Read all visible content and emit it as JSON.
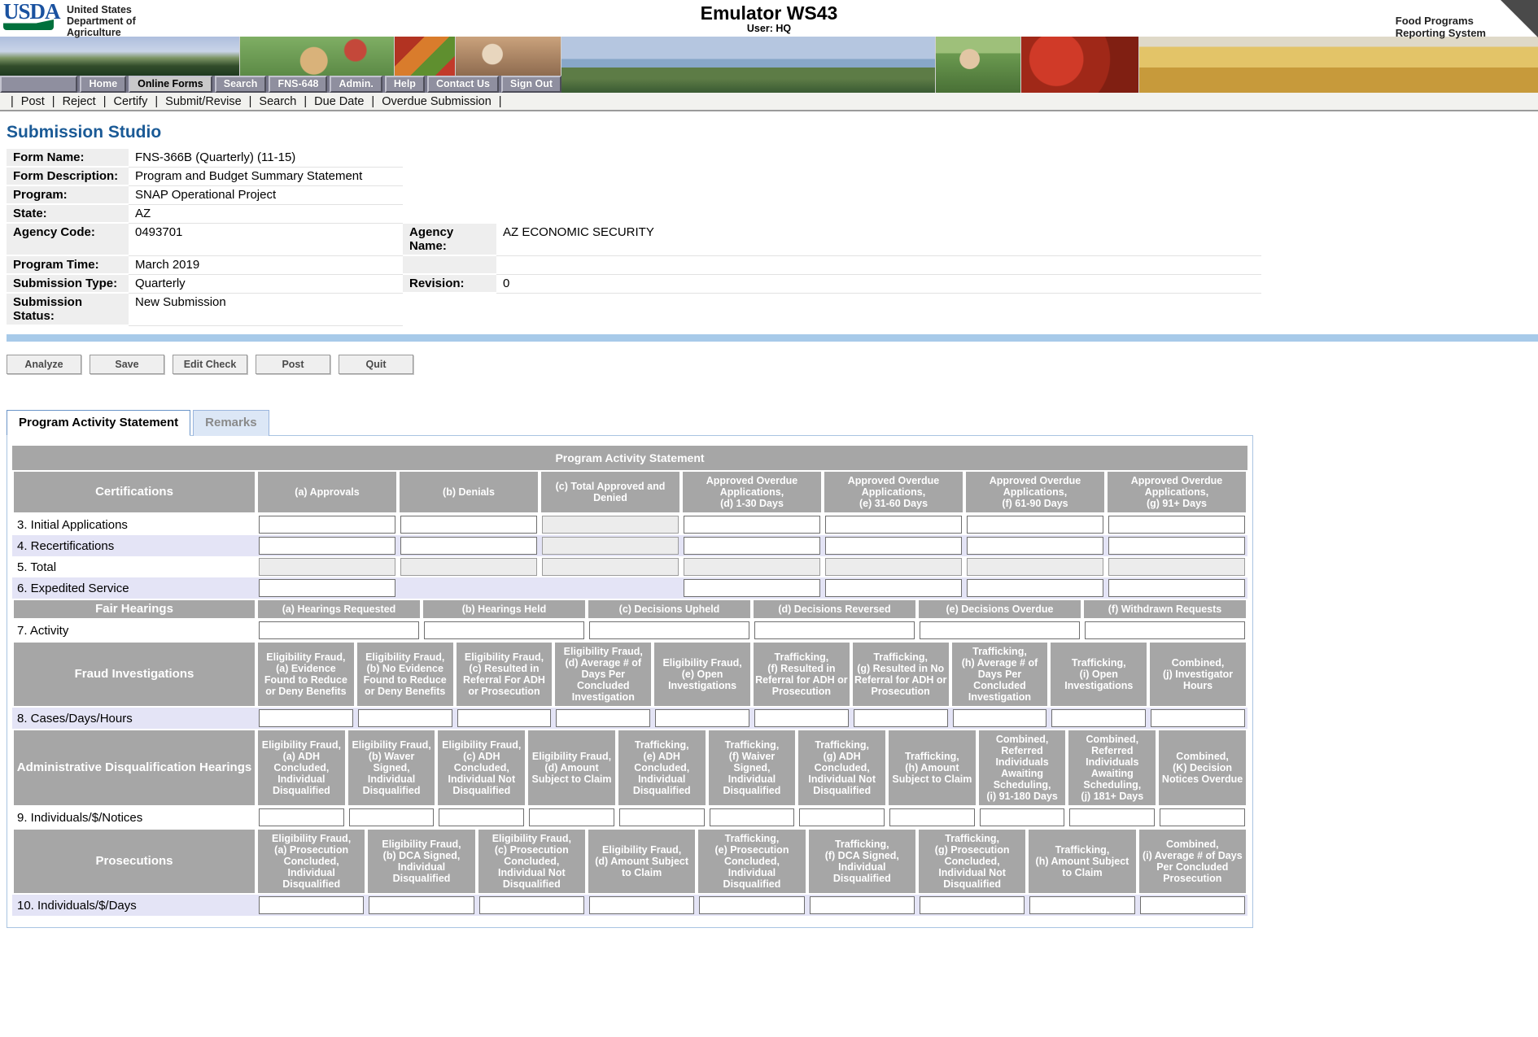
{
  "header": {
    "logo": "USDA",
    "agency_lines": [
      "United States",
      "Department of",
      "Agriculture"
    ],
    "title": "Emulator WS43",
    "user_label": "User: HQ",
    "system_lines": [
      "Food Programs",
      "Reporting System"
    ]
  },
  "nav": {
    "items": [
      {
        "label": "Home",
        "active": false
      },
      {
        "label": "Online Forms",
        "active": true
      },
      {
        "label": "Search",
        "active": false
      },
      {
        "label": "FNS-648",
        "active": false
      },
      {
        "label": "Admin.",
        "active": false
      },
      {
        "label": "Help",
        "active": false
      },
      {
        "label": "Contact Us",
        "active": false
      },
      {
        "label": "Sign Out",
        "active": false
      }
    ]
  },
  "subnav": {
    "items": [
      "Post",
      "Reject",
      "Certify",
      "Submit/Revise",
      "Search",
      "Due Date",
      "Overdue Submission"
    ]
  },
  "page_title": "Submission Studio",
  "metadata": {
    "rows": [
      {
        "label": "Form Name:",
        "value": "FNS-366B (Quarterly) (11-15)",
        "label2": null,
        "value2": null
      },
      {
        "label": "Form Description:",
        "value": "Program and Budget Summary Statement",
        "label2": null,
        "value2": null
      },
      {
        "label": "Program:",
        "value": "SNAP Operational Project",
        "label2": null,
        "value2": null
      },
      {
        "label": "State:",
        "value": "AZ",
        "label2": null,
        "value2": null
      },
      {
        "label": "Agency Code:",
        "value": "0493701",
        "label2": "Agency Name:",
        "value2": "AZ ECONOMIC SECURITY"
      },
      {
        "label": "Program Time:",
        "value": "March 2019",
        "label2": "",
        "value2": ""
      },
      {
        "label": "Submission Type:",
        "value": "Quarterly",
        "label2": "Revision:",
        "value2": "0"
      },
      {
        "label": "Submission Status:",
        "value": "New Submission",
        "label2": null,
        "value2": null
      }
    ]
  },
  "toolbar": {
    "buttons": [
      "Analyze",
      "Save",
      "Edit Check",
      "Post",
      "Quit"
    ]
  },
  "tabs": [
    {
      "label": "Program Activity Statement",
      "active": true
    },
    {
      "label": "Remarks",
      "active": false
    }
  ],
  "table": {
    "title": "Program Activity Statement",
    "sections": [
      {
        "name": "Certifications",
        "columns": [
          "(a) Approvals",
          "(b) Denials",
          "(c) Total Approved and Denied",
          "Approved Overdue Applications,\n(d) 1-30 Days",
          "Approved Overdue Applications,\n(e) 31-60 Days",
          "Approved Overdue Applications,\n(f) 61-90 Days",
          "Approved Overdue Applications,\n(g) 91+ Days"
        ],
        "rows": [
          {
            "label": "3. Initial Applications",
            "shade": false,
            "cells": [
              "input",
              "input",
              "disabled",
              "input",
              "input",
              "input",
              "input"
            ]
          },
          {
            "label": "4. Recertifications",
            "shade": true,
            "cells": [
              "input",
              "input",
              "disabled",
              "input",
              "input",
              "input",
              "input"
            ]
          },
          {
            "label": "5. Total",
            "shade": false,
            "cells": [
              "disabled",
              "disabled",
              "disabled",
              "disabled",
              "disabled",
              "disabled",
              "disabled"
            ]
          },
          {
            "label": "6. Expedited Service",
            "shade": true,
            "cells": [
              "input",
              "empty",
              "empty",
              "input",
              "input",
              "input",
              "input"
            ]
          }
        ]
      },
      {
        "name": "Fair Hearings",
        "columns": [
          "(a) Hearings Requested",
          "(b) Hearings Held",
          "(c) Decisions Upheld",
          "(d) Decisions Reversed",
          "(e) Decisions Overdue",
          "(f) Withdrawn Requests"
        ],
        "rows": [
          {
            "label": "7. Activity",
            "shade": false,
            "cells": [
              "input",
              "input",
              "input",
              "input",
              "input",
              "input"
            ]
          }
        ]
      },
      {
        "name": "Fraud Investigations",
        "columns": [
          "Eligibility Fraud,\n(a) Evidence Found to Reduce or Deny Benefits",
          "Eligibility Fraud,\n(b) No Evidence Found to Reduce or Deny Benefits",
          "Eligibility Fraud,\n(c) Resulted in Referral For ADH or Prosecution",
          "Eligibility Fraud,\n(d) Average # of Days Per Concluded Investigation",
          "Eligibility Fraud,\n(e) Open Investigations",
          "Trafficking,\n(f) Resulted in Referral for ADH or Prosecution",
          "Trafficking,\n(g) Resulted in No Referral for ADH or Prosecution",
          "Trafficking,\n(h) Average # of Days Per Concluded Investigation",
          "Trafficking,\n(i) Open Investigations",
          "Combined,\n(j) Investigator Hours"
        ],
        "rows": [
          {
            "label": "8. Cases/Days/Hours",
            "shade": true,
            "cells": [
              "input",
              "input",
              "input",
              "input",
              "input",
              "input",
              "input",
              "input",
              "input",
              "input"
            ]
          }
        ]
      },
      {
        "name": "Administrative Disqualification Hearings",
        "columns": [
          "Eligibility Fraud,\n(a) ADH Concluded,\nIndividual Disqualified",
          "Eligibility Fraud,\n(b) Waver Signed,\nIndividual Disqualified",
          "Eligibility Fraud,\n(c) ADH Concluded,\nIndividual Not Disqualified",
          "Eligibility Fraud,\n(d) Amount Subject to Claim",
          "Trafficking,\n(e) ADH Concluded,\nIndividual Disqualified",
          "Trafficking,\n(f) Waiver Signed,\nIndividual Disqualified",
          "Trafficking,\n(g) ADH Concluded,\nIndividual Not Disqualified",
          "Trafficking,\n(h) Amount Subject to Claim",
          "Combined,\nReferred Individuals Awaiting Scheduling,\n(i) 91-180 Days",
          "Combined,\nReferred Individuals Awaiting Scheduling,\n(j) 181+ Days",
          "Combined,\n(K) Decision Notices Overdue"
        ],
        "rows": [
          {
            "label": "9. Individuals/$/Notices",
            "shade": false,
            "cells": [
              "input",
              "input",
              "input",
              "input",
              "input",
              "input",
              "input",
              "input",
              "input",
              "input",
              "input"
            ]
          }
        ]
      },
      {
        "name": "Prosecutions",
        "columns": [
          "Eligibility Fraud,\n(a) Prosecution Concluded,\nIndividual Disqualified",
          "Eligibility Fraud,\n(b) DCA Signed,\nIndividual Disqualified",
          "Eligibility Fraud,\n(c) Prosecution Concluded,\nIndividual Not Disqualified",
          "Eligibility Fraud,\n(d) Amount Subject to Claim",
          "Trafficking,\n(e) Prosecution Concluded,\nIndividual Disqualified",
          "Trafficking,\n(f) DCA Signed,\nIndividual Disqualified",
          "Trafficking,\n(g) Prosecution Concluded,\nIndividual Not Disqualified",
          "Trafficking,\n(h) Amount Subject to Claim",
          "Combined,\n(i) Average # of Days Per Concluded Prosecution"
        ],
        "rows": [
          {
            "label": "10. Individuals/$/Days",
            "shade": true,
            "cells": [
              "input",
              "input",
              "input",
              "input",
              "input",
              "input",
              "input",
              "input",
              "input"
            ]
          }
        ]
      }
    ]
  }
}
